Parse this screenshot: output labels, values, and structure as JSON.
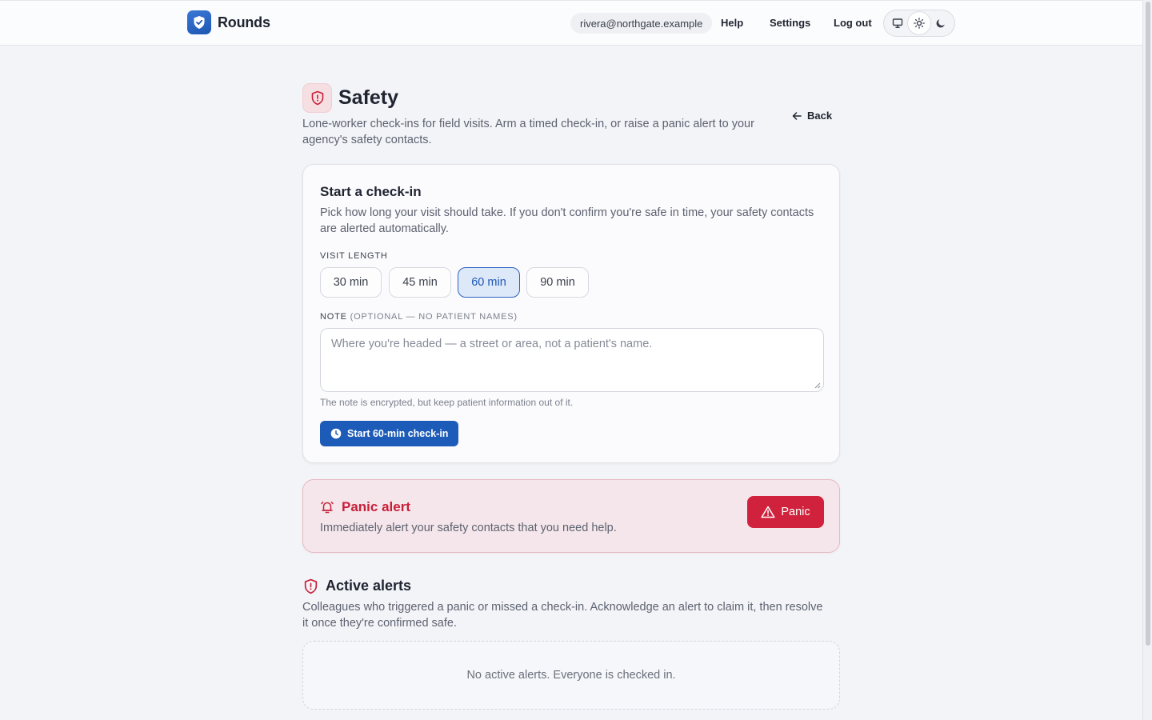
{
  "header": {
    "brand": "Rounds",
    "email": "rivera@northgate.example",
    "nav": {
      "help": "Help",
      "settings": "Settings",
      "logout": "Log out"
    },
    "theme_options": [
      "monitor-icon",
      "sun-icon",
      "moon-icon"
    ],
    "theme_selected": "sun-icon"
  },
  "page": {
    "title": "Safety",
    "description": "Lone-worker check-ins for field visits. Arm a timed check-in, or raise a panic alert to your agency's safety contacts.",
    "back_label": "Back"
  },
  "checkin": {
    "title": "Start a check-in",
    "description": "Pick how long your visit should take. If you don't confirm you're safe in time, your safety contacts are alerted automatically.",
    "visit_length_label": "VISIT LENGTH",
    "options": [
      "30 min",
      "45 min",
      "60 min",
      "90 min"
    ],
    "selected_option": "60 min",
    "note_label": "NOTE",
    "note_label_hint": "(OPTIONAL — NO PATIENT NAMES)",
    "note_placeholder": "Where you're headed — a street or area, not a patient's name.",
    "note_value": "",
    "helper": "The note is encrypted, but keep patient information out of it.",
    "start_label": "Start 60-min check-in"
  },
  "panic": {
    "title": "Panic alert",
    "description": "Immediately alert your safety contacts that you need help.",
    "button_label": "Panic"
  },
  "alerts": {
    "title": "Active alerts",
    "description": "Colleagues who triggered a panic or missed a check-in. Acknowledge an alert to claim it, then resolve it once they're confirmed safe.",
    "empty_message": "No active alerts. Everyone is checked in."
  },
  "colors": {
    "primary": "#1d5bb8",
    "danger": "#d0223c",
    "danger_bg": "#f4e6ea",
    "page_bg": "#f3f4f8"
  }
}
